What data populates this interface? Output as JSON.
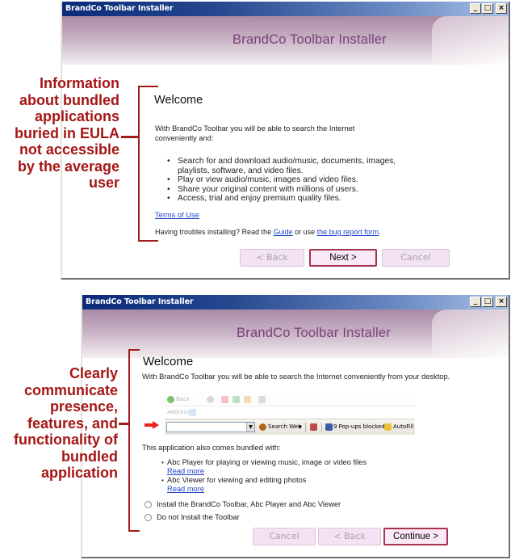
{
  "colors": {
    "annotation_red": "#a51616",
    "banner_title": "#7a3f78",
    "primary_button_border": "#a8324e",
    "link": "#1f44c9"
  },
  "window1": {
    "titlebar_title": "BrandCo Toolbar Installer",
    "titlebar_buttons": {
      "minimize": "_",
      "maximize": "□",
      "close": "×"
    },
    "banner_title": "BrandCo Toolbar Installer",
    "heading": "Welcome",
    "intro": "With BrandCo Toolbar you will be able to search the Internet conveniently and:",
    "features": [
      "Search for and download audio/music, documents, images, playlists, software, and video files.",
      "Play or view audio/music, images and video files.",
      "Share your original content with millions of users.",
      "Access, trial and enjoy premium quality files."
    ],
    "terms_link": "Terms of Use",
    "help": {
      "prefix": "Having troubles installing? Read the ",
      "guide_link": "Guide",
      "middle": " or use ",
      "bug_link": "the bug report form",
      "suffix": "."
    },
    "buttons": {
      "back": "< Back",
      "next": "Next >",
      "cancel": "Cancel"
    },
    "annotation": "Information about bundled applications buried in EULA not accessible by the average user"
  },
  "window2": {
    "titlebar_title": "BrandCo Toolbar Installer",
    "titlebar_buttons": {
      "minimize": "_",
      "maximize": "□",
      "close": "×"
    },
    "banner_title": "BrandCo Toolbar Installer",
    "heading": "Welcome",
    "intro": "With BrandCo Toolbar you will be able to search the Internet conveniently from your desktop.",
    "browser_preview": {
      "back_label": "Back",
      "address_label": "Address",
      "search_web_label": "Search Web",
      "popups_label": "9 Pop-ups blocked",
      "autofill_label": "AutoFill"
    },
    "bundled_heading": "This application also comes bundled with:",
    "bundled_apps": [
      {
        "description": "Abc Player for playing or viewing music, image or video files",
        "link": "Read more"
      },
      {
        "description": "Abc Viewer for viewing and editing photos",
        "link": "Read more"
      }
    ],
    "options": [
      {
        "label": "Install the BrandCo Toolbar, Abc Player and Abc Viewer",
        "selected": false
      },
      {
        "label": "Do not Install the Toolbar",
        "selected": false
      }
    ],
    "buttons": {
      "cancel": "Cancel",
      "back": "< Back",
      "continue": "Continue >"
    },
    "annotation": "Clearly communicate presence, features, and functionality of bundled application"
  }
}
